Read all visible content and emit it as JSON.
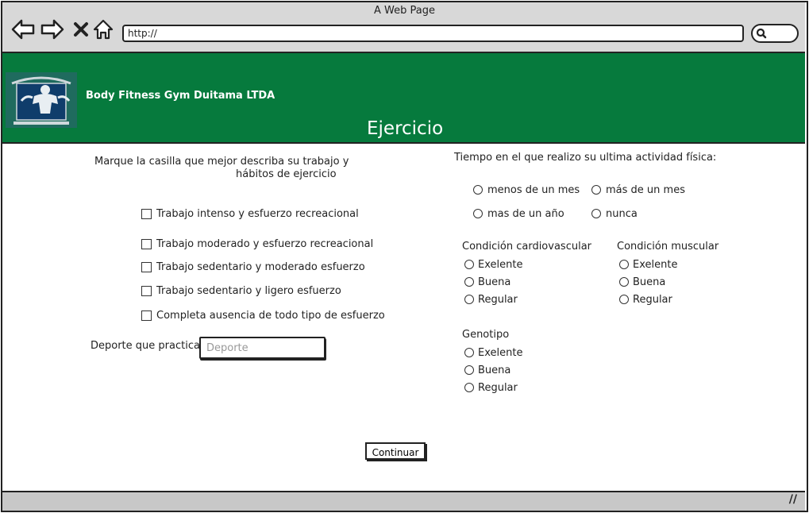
{
  "window": {
    "title": "A Web Page",
    "url": "http://"
  },
  "header": {
    "brand": "Body Fitness Gym Duitama LTDA",
    "page_title": "Ejercicio"
  },
  "left": {
    "instruction_line1": "Marque la casilla que mejor describa su trabajo y",
    "instruction_line2": "hábitos de ejercicio",
    "options": [
      "Trabajo intenso y esfuerzo recreacional",
      "Trabajo moderado y esfuerzo recreacional",
      "Trabajo sedentario y moderado esfuerzo",
      "Trabajo sedentario y ligero esfuerzo",
      "Completa ausencia de todo tipo de esfuerzo"
    ],
    "sport_label": "Deporte que practica:",
    "sport_placeholder": "Deporte"
  },
  "right": {
    "time_question": "Tiempo en el que realizo su ultima actividad física:",
    "time_options": [
      "menos de un mes",
      "más de un mes",
      "mas de un año",
      "nunca"
    ],
    "cardio": {
      "label": "Condición cardiovascular",
      "options": [
        "Exelente",
        "Buena",
        "Regular"
      ]
    },
    "muscular": {
      "label": "Condición muscular",
      "options": [
        "Exelente",
        "Buena",
        "Regular"
      ]
    },
    "genotype": {
      "label": "Genotipo",
      "options": [
        "Exelente",
        "Buena",
        "Regular"
      ]
    }
  },
  "actions": {
    "continue_label": "Continuar"
  },
  "colors": {
    "header_bg": "#067a3d",
    "chrome_bg": "#d8d8d8"
  },
  "icons": [
    "back-arrow-icon",
    "forward-arrow-icon",
    "close-x-icon",
    "home-icon",
    "search-icon",
    "resize-grip-icon"
  ]
}
